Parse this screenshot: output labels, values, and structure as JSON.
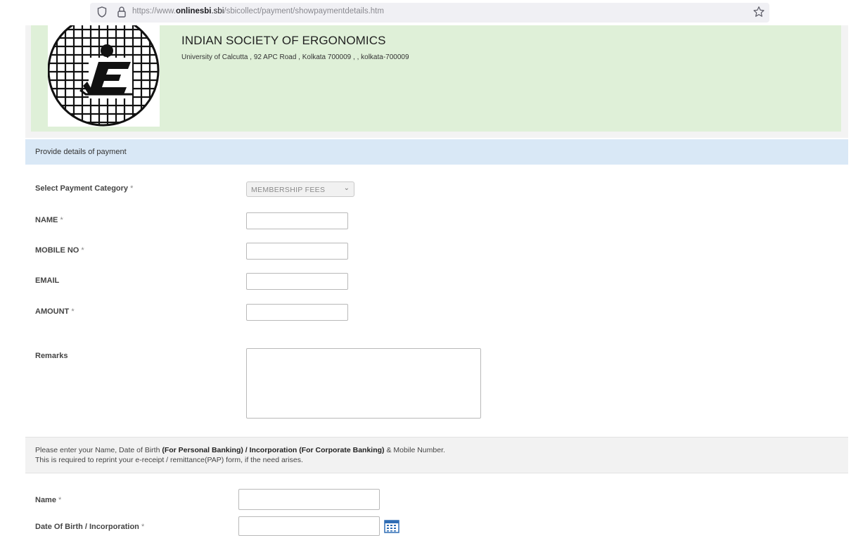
{
  "browser": {
    "url_prefix": "https://www.",
    "url_domain_bold": "onlinesbi",
    "url_domain_rest": ".sbi",
    "url_path": "/sbicollect/payment/showpaymentdetails.htm"
  },
  "header": {
    "org_name": "INDIAN SOCIETY OF ERGONOMICS",
    "org_address": "University of Calcutta , 92 APC Road , Kolkata 700009 , , kolkata-700009"
  },
  "section": {
    "title": "Provide details of payment"
  },
  "form": {
    "category_label": "Select Payment Category",
    "category_value": "MEMBERSHIP FEES",
    "name_label": "NAME",
    "mobile_label": "MOBILE NO",
    "email_label": "EMAIL",
    "amount_label": "AMOUNT",
    "remarks_label": "Remarks",
    "required_mark": "*"
  },
  "notice": {
    "line1_a": "Please enter your Name, Date of Birth ",
    "line1_b": "(For Personal Banking) / Incorporation (For Corporate Banking)",
    "line1_c": " & Mobile Number.",
    "line2": "This is required to reprint your e-receipt / remittance(PAP) form, if the need arises."
  },
  "reprint": {
    "name_label": "Name",
    "dob_label": "Date Of Birth / Incorporation"
  },
  "colors": {
    "header_bg": "#dff0d8",
    "section_bg": "#d9e8f6",
    "calendar_blue": "#2f6db5"
  },
  "icons": {
    "shield": "shield-icon",
    "lock": "lock-icon",
    "star": "bookmark-star-icon",
    "calendar": "calendar-icon",
    "logo": "ise-logo"
  }
}
